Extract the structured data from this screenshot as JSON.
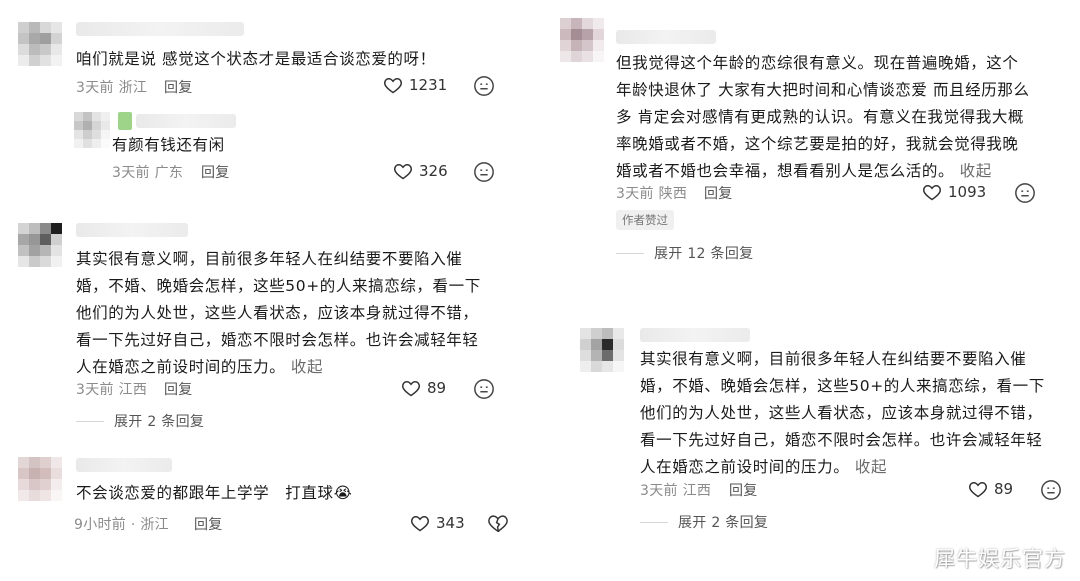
{
  "left": {
    "c1": {
      "text": "咱们就是说 感觉这个状态才是最适合谈恋爱的呀！",
      "time": "3天前",
      "location": "浙江",
      "reply": "回复",
      "likes": "1231"
    },
    "c1_sub": {
      "text": "有颜有钱还有闲",
      "time": "3天前",
      "location": "广东",
      "reply": "回复",
      "likes": "326"
    },
    "c2": {
      "lines": [
        "其实很有意义啊，目前很多年轻人在纠结要不要陷入催",
        "婚，不婚、晚婚会怎样，这些50+的人来搞恋综，看一下",
        "他们的为人处世，这些人看状态，应该本身就过得不错，",
        "看一下先过好自己，婚恋不限时会怎样。也许会减轻年轻"
      ],
      "last_line": "人在婚恋之前设时间的压力。",
      "fold": "收起",
      "time": "3天前",
      "location": "江西",
      "reply": "回复",
      "likes": "89",
      "expand": "展开 2 条回复"
    },
    "c3": {
      "text": "不会谈恋爱的都跟年上学学　打直球😭",
      "time": "9小时前 · 浙江",
      "reply": "回复",
      "likes": "343"
    }
  },
  "right": {
    "c1": {
      "lines": [
        "但我觉得这个年龄的恋综很有意义。现在普遍晚婚，这个",
        "年龄快退休了 大家有大把时间和心情谈恋爱 而且经历那么",
        "多 肯定会对感情有更成熟的认识。有意义在我觉得我大概",
        "率晚婚或者不婚，这个综艺要是拍的好，我就会觉得我晚"
      ],
      "last_line": "婚或者不婚也会幸福，想看看别人是怎么活的。",
      "fold": "收起",
      "time": "3天前",
      "location": "陕西",
      "reply": "回复",
      "likes": "1093",
      "badge": "作者赞过",
      "expand": "展开 12 条回复"
    },
    "c2": {
      "lines": [
        "其实很有意义啊，目前很多年轻人在纠结要不要陷入催",
        "婚，不婚、晚婚会怎样，这些50+的人来搞恋综，看一下",
        "他们的为人处世，这些人看状态，应该本身就过得不错，",
        "看一下先过好自己，婚恋不限时会怎样。也许会减轻年轻"
      ],
      "last_line": "人在婚恋之前设时间的压力。",
      "fold": "收起",
      "time": "3天前",
      "location": "江西",
      "reply": "回复",
      "likes": "89",
      "expand": "展开 2 条回复"
    }
  },
  "watermark": "犀牛娱乐官方"
}
